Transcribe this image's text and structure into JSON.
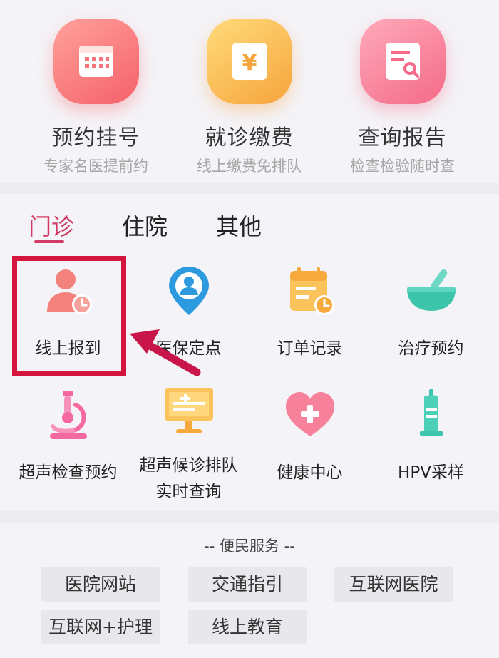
{
  "top_services": [
    {
      "title": "预约挂号",
      "subtitle": "专家名医提前约",
      "icon": "calendar-icon",
      "color_from": "#ff8e86",
      "color_to": "#f7646a"
    },
    {
      "title": "就诊缴费",
      "subtitle": "线上缴费免排队",
      "icon": "yuan-payment-icon",
      "color_from": "#ffd36e",
      "color_to": "#f7a940"
    },
    {
      "title": "查询报告",
      "subtitle": "检查检验随时查",
      "icon": "report-search-icon",
      "color_from": "#ff9bb0",
      "color_to": "#f76e8a"
    }
  ],
  "tabs": [
    {
      "label": "门诊",
      "active": true
    },
    {
      "label": "住院",
      "active": false
    },
    {
      "label": "其他",
      "active": false
    }
  ],
  "grid": [
    {
      "label": "线上报到",
      "icon": "user-clock-icon"
    },
    {
      "label": "医保定点",
      "icon": "location-person-icon"
    },
    {
      "label": "订单记录",
      "icon": "order-record-icon"
    },
    {
      "label": "治疗预约",
      "icon": "mortar-bowl-icon"
    },
    {
      "label": "超声检查预约",
      "icon": "microscope-icon"
    },
    {
      "label": "超声候诊排队\n实时查询",
      "label_line1": "超声候诊排队",
      "label_line2": "实时查询",
      "icon": "monitor-plus-icon"
    },
    {
      "label": "健康中心",
      "icon": "heart-plus-icon"
    },
    {
      "label": "HPV采样",
      "icon": "sample-bottle-icon"
    }
  ],
  "convenience": {
    "title": "-- 便民服务 --",
    "items": [
      "医院网站",
      "交通指引",
      "互联网医院",
      "互联网+护理",
      "线上教育"
    ]
  },
  "colors": {
    "accent": "#d23b64",
    "highlight_border": "#d4163f",
    "arrow": "#c8164a"
  }
}
